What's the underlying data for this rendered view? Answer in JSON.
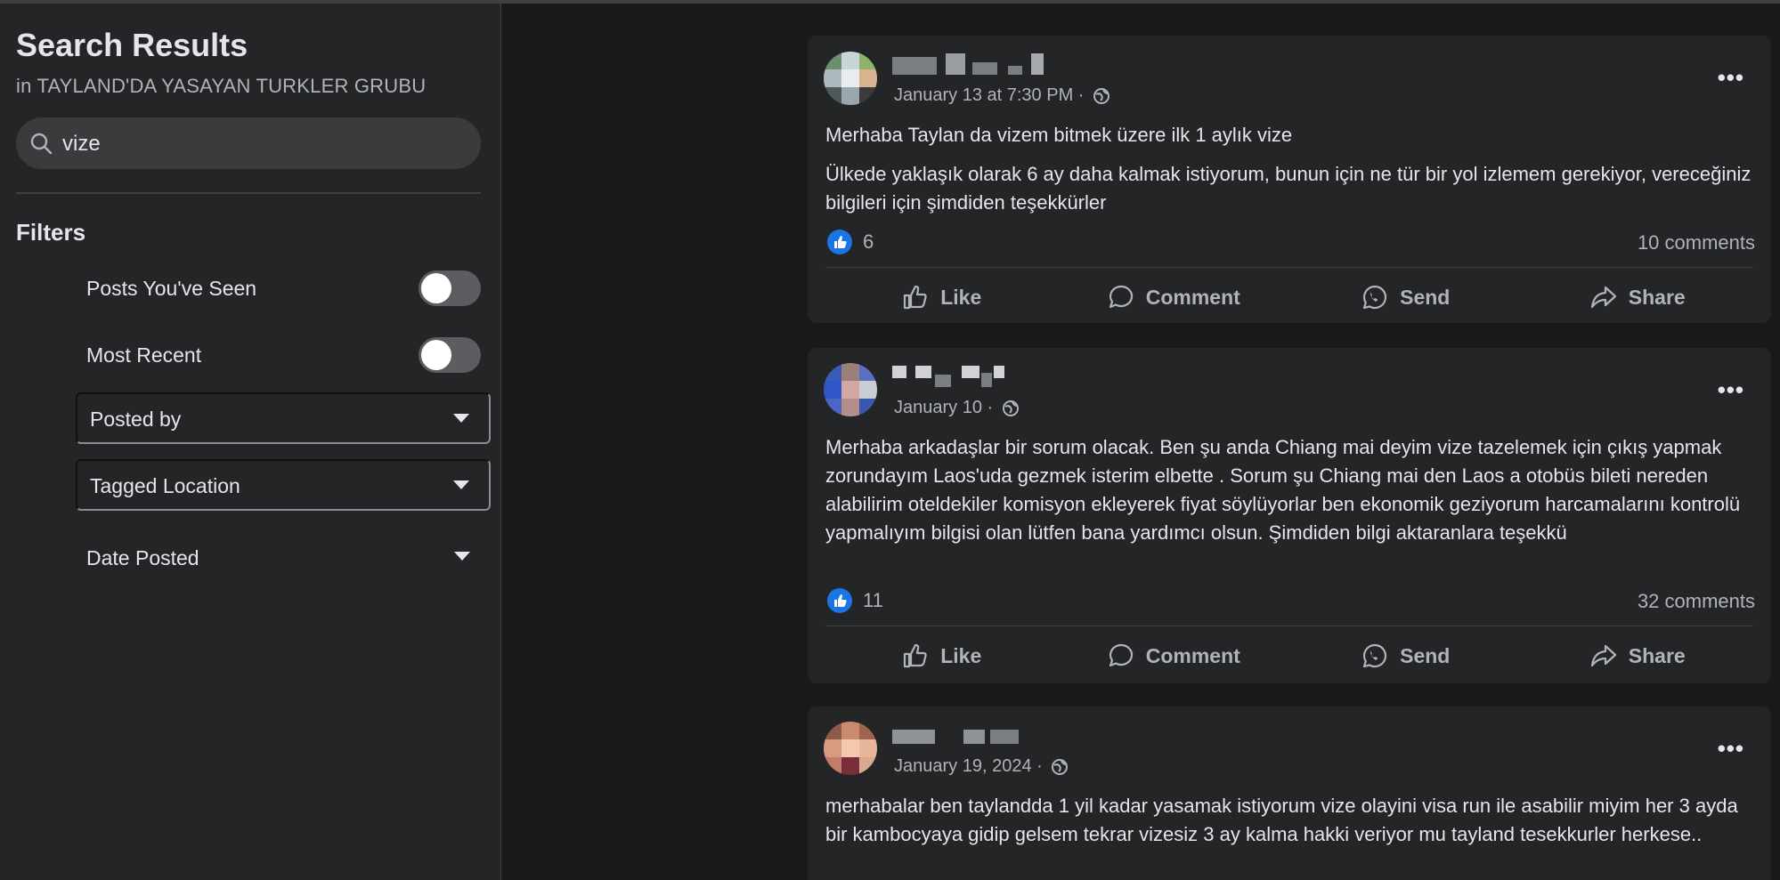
{
  "sidebar": {
    "title": "Search Results",
    "subtitle": "in TAYLAND'DA YASAYAN TURKLER GRUBU",
    "search": {
      "value": "vize",
      "icon": "search-icon"
    },
    "filters_heading": "Filters",
    "filters": {
      "posts_seen": {
        "label": "Posts You've Seen",
        "on": false
      },
      "most_recent": {
        "label": "Most Recent",
        "on": false
      },
      "posted_by": {
        "label": "Posted by"
      },
      "tagged_location": {
        "label": "Tagged Location"
      },
      "date_posted": {
        "label": "Date Posted"
      }
    }
  },
  "actions": {
    "like": "Like",
    "comment": "Comment",
    "send": "Send",
    "share": "Share"
  },
  "posts": [
    {
      "date": "January 13 at 7:30 PM · ",
      "text": [
        "Merhaba Taylan da vizem bitmek üzere ilk 1 aylık vize",
        "Ülkede yaklaşık olarak 6 ay daha kalmak istiyorum, bunun için ne tür bir yol izlemem gerekiyor, vereceğiniz bilgileri için şimdiden teşekkürler"
      ],
      "likes": "6",
      "comments": "10 comments"
    },
    {
      "date": "January 10 · ",
      "text": [
        "Merhaba arkadaşlar bir sorum olacak. Ben şu anda Chiang mai deyim  vize tazelemek için çıkış yapmak zorundayım  Laos'uda gezmek isterim elbette . Sorum şu  Chiang mai den Laos a otobüs bileti nereden alabilirim oteldekiler komisyon ekleyerek  fiyat söylüyorlar ben ekonomik geziyorum harcamalarını kontrolü yapmalıyım  bilgisi olan lütfen bana yardımcı olsun. Şimdiden bilgi aktaranlara teşekkü"
      ],
      "likes": "11",
      "comments": "32 comments"
    },
    {
      "date": "January 19, 2024 · ",
      "text": [
        "merhabalar ben taylandda 1 yil kadar yasamak istiyorum vize olayini visa run ile asabilir miyim her 3 ayda bir kambocyaya gidip gelsem tekrar vizesiz 3 ay kalma hakki veriyor mu tayland tesekkurler herkese.."
      ]
    }
  ],
  "colors": {
    "accent": "#1b74e4",
    "background": "#18191a",
    "card": "#242526"
  }
}
